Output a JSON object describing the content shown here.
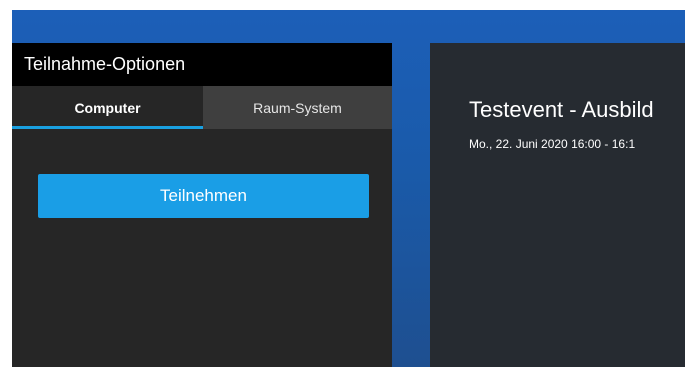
{
  "join_options": {
    "title": "Teilnahme-Optionen",
    "tabs": [
      {
        "label": "Computer",
        "selected": true
      },
      {
        "label": "Raum-System",
        "selected": false
      }
    ],
    "join_button_label": "Teilnehmen"
  },
  "event": {
    "title": "Testevent - Ausbild",
    "datetime": "Mo., 22. Juni 2020 16:00 - 16:1"
  },
  "colors": {
    "accent": "#1a9ee6",
    "background_blue": "#1c5fb8",
    "panel_dark": "#262626",
    "header_black": "#000000",
    "event_panel": "#262b31"
  }
}
